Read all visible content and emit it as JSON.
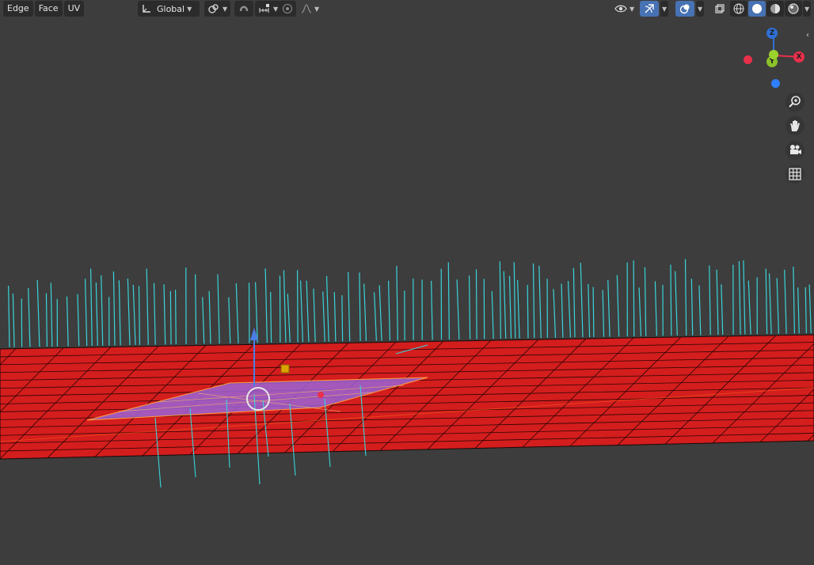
{
  "header": {
    "menus": [
      {
        "id": "edge",
        "label": "Edge"
      },
      {
        "id": "face",
        "label": "Face"
      },
      {
        "id": "uv",
        "label": "UV"
      }
    ],
    "transform_orientation": {
      "label": "Global",
      "icon": "orientation-axes-icon"
    },
    "pivot_icon": "pivot-point-icon",
    "snap_icons": [
      "snap-toggle-icon",
      "snap-increment-icon"
    ],
    "proportional_icons": [
      "proportional-editing-icon",
      "falloff-curve-icon"
    ],
    "right_icons": [
      "visibility-eye-icon",
      "gizmo-toggle-icon",
      "overlay-toggle-icon",
      "xray-toggle-icon",
      "wireframe-shading-icon",
      "solid-shading-icon",
      "material-shading-icon",
      "rendered-shading-icon"
    ]
  },
  "gizmo": {
    "axes": [
      {
        "id": "z",
        "label": "Z",
        "color": "#2f6fd6"
      },
      {
        "id": "x",
        "label": "X",
        "color": "#e8304a"
      },
      {
        "id": "y",
        "label": "Y",
        "color": "#8cc12a"
      }
    ]
  },
  "nav_tools": [
    "zoom-icon",
    "pan-hand-icon",
    "camera-view-icon",
    "ortho-grid-icon"
  ],
  "colors": {
    "background": "#3d3d3d",
    "mesh": "#d41d1d",
    "selection": "#9a63d6",
    "normals": "#39d4da",
    "edge_highlight": "#ff8a1f"
  }
}
